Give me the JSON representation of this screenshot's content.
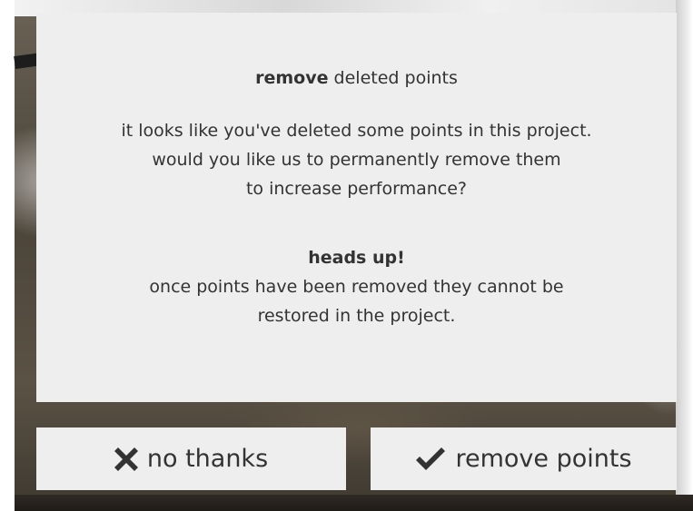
{
  "dialog": {
    "title_bold": "remove",
    "title_rest": " deleted points",
    "body_lines": [
      "it looks like you've deleted some points in this project.",
      "would you like us to permanently remove them",
      "to increase performance?"
    ],
    "warning_title": "heads up!",
    "warning_lines": [
      "once points have been removed they cannot be",
      "restored in the project."
    ]
  },
  "buttons": {
    "no_label": "no thanks",
    "no_icon": "close-x-icon",
    "yes_label": "remove points",
    "yes_icon": "checkmark-icon"
  },
  "colors": {
    "dialog_bg": "#eeeeee",
    "text": "#333333"
  }
}
